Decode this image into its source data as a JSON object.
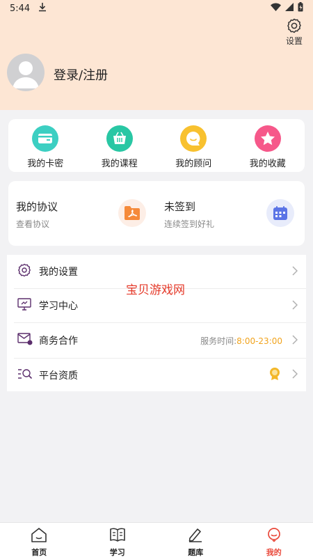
{
  "status_bar": {
    "time": "5:44"
  },
  "header": {
    "settings_label": "设置",
    "login_label": "登录/注册"
  },
  "quick_links": [
    {
      "label": "我的卡密",
      "icon": "card-icon",
      "color": "#3ccfc2"
    },
    {
      "label": "我的课程",
      "icon": "basket-icon",
      "color": "#29c7a4"
    },
    {
      "label": "我的顾问",
      "icon": "chat-bubble-icon",
      "color": "#f8c12f"
    },
    {
      "label": "我的收藏",
      "icon": "star-icon",
      "color": "#f6588a"
    }
  ],
  "agreement": {
    "title": "我的协议",
    "subtitle": "查看协议"
  },
  "checkin": {
    "title": "未签到",
    "subtitle": "连续签到好礼"
  },
  "menu": {
    "settings": "我的设置",
    "study_center": "学习中心",
    "business": "商务合作",
    "business_hours_label": "服务时间:",
    "business_hours": "8:00-23:00",
    "qualification": "平台资质"
  },
  "watermark": "宝贝游戏网",
  "tabs": [
    {
      "label": "首页"
    },
    {
      "label": "学习"
    },
    {
      "label": "题库"
    },
    {
      "label": "我的"
    }
  ],
  "colors": {
    "header_bg": "#fde6d4",
    "accent": "#e9483a",
    "hours": "#f1a31c"
  }
}
